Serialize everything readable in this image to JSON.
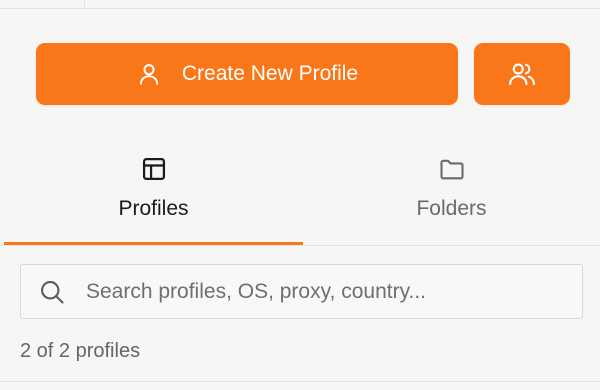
{
  "colors": {
    "accent": "#f97718",
    "background": "#f6f6f5",
    "text_active": "#1a1a1a",
    "text_muted": "#6a6a6a"
  },
  "actions": {
    "create_label": "Create New Profile",
    "create_icon": "user-icon",
    "team_icon": "users-icon"
  },
  "tabs": [
    {
      "label": "Profiles",
      "icon": "layout-icon",
      "active": true
    },
    {
      "label": "Folders",
      "icon": "folder-icon",
      "active": false
    }
  ],
  "search": {
    "placeholder": "Search profiles, OS, proxy, country...",
    "value": "",
    "icon": "search-icon"
  },
  "status": {
    "count_text": "2 of 2 profiles"
  }
}
